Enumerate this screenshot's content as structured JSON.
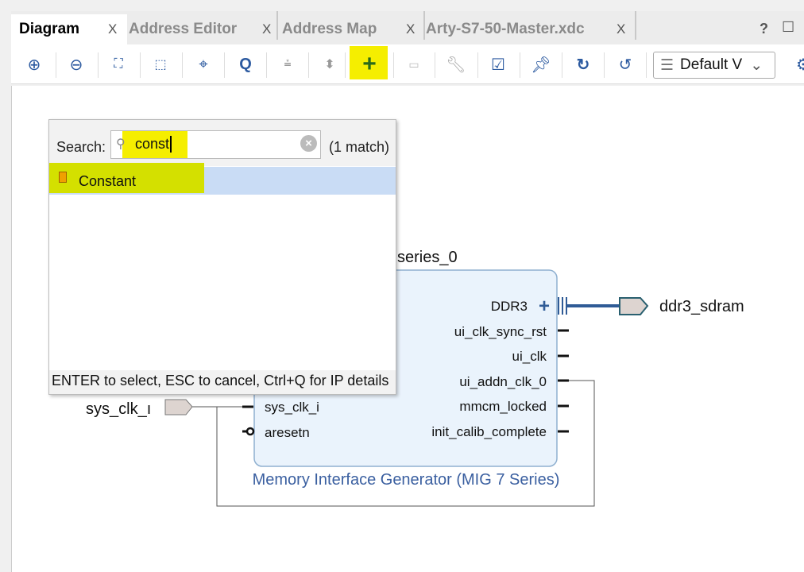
{
  "tabs": [
    {
      "label": "Diagram",
      "active": true
    },
    {
      "label": "Address Editor"
    },
    {
      "label": "Address Map"
    },
    {
      "label": "Arty-S7-50-Master.xdc"
    }
  ],
  "tab_close": "X",
  "window_controls": {
    "help": "?",
    "maximize": "☐"
  },
  "toolbar": {
    "icons": [
      "zoom-in-icon",
      "zoom-out-icon",
      "fit-icon",
      "select-area-icon",
      "center-icon",
      "search-icon",
      "collapse-icon",
      "expand-icon",
      "add-ip-icon",
      "make-external-icon",
      "wrench-icon",
      "validate-icon",
      "pin-icon",
      "refresh-icon",
      "regenerate-layout-icon"
    ],
    "view_select": "Default V",
    "highlight_color": "#f5ee00"
  },
  "search_popup": {
    "label": "Search:",
    "value": "const",
    "match_count": "(1 match)",
    "results": [
      {
        "label": "Constant",
        "selected": true
      }
    ],
    "footer": "ENTER to select, ESC to cancel, Ctrl+Q for IP details"
  },
  "diagram": {
    "instance_name": "series_0",
    "block_title": "Memory Interface Generator (MIG 7 Series)",
    "left_ports": [
      "sys_clk_i",
      "aresetn"
    ],
    "right_ports": [
      "DDR3",
      "ui_clk_sync_rst",
      "ui_clk",
      "ui_addn_clk_0",
      "mmcm_locked",
      "init_calib_complete"
    ],
    "external_in": "sys_clk_ı",
    "external_out": "ddr3_sdram",
    "colors": {
      "block_fill": "#eaf3fc",
      "block_border": "#8fb0d0",
      "title": "#3a5fa0",
      "bus": "#2f5b96"
    }
  }
}
